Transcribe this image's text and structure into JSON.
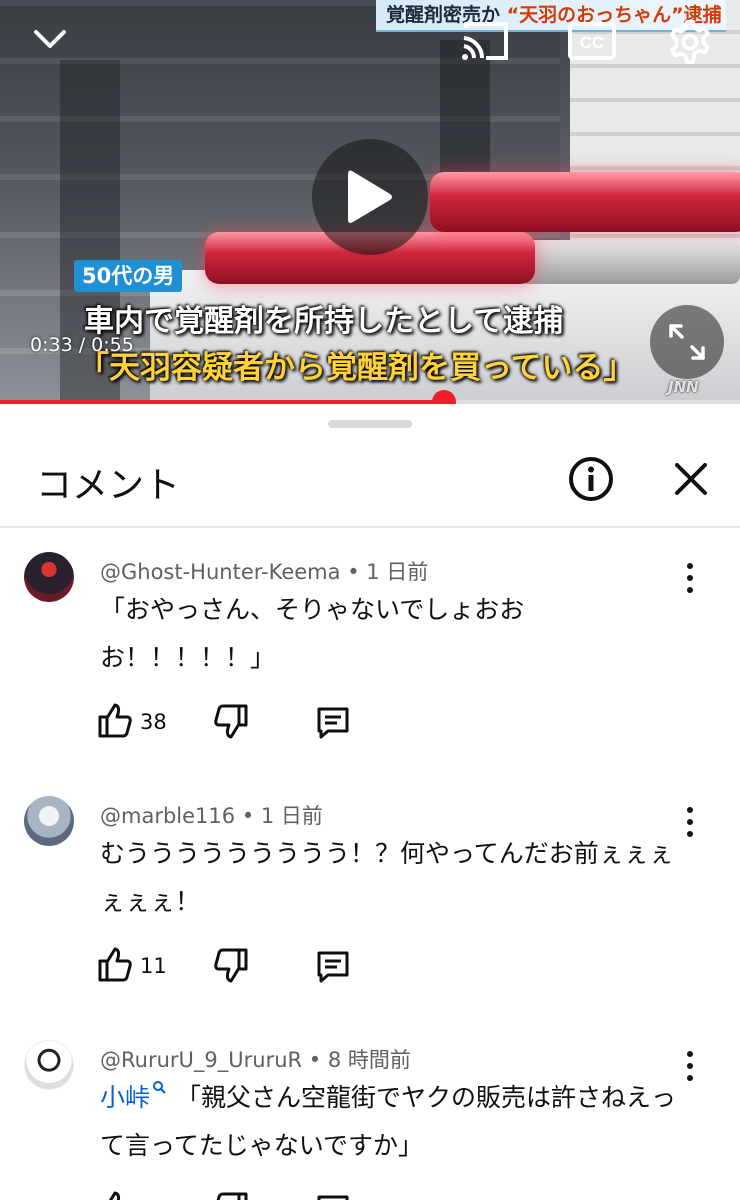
{
  "video": {
    "top_caption": "覚醒剤密売か",
    "top_caption_highlight": "“天羽のおっちゃん”逮捕",
    "tag": "50代の男",
    "subtitle_line1": "車内で覚醒剤を所持したとして逮捕",
    "subtitle_line2": "「天羽容疑者から覚醒剤を買っている」",
    "time": "0:33 / 0:55",
    "progress": 0.6,
    "watermark": "JNN",
    "icons": [
      "chevron-down-icon",
      "cast-icon",
      "closed-captions-icon",
      "settings-gear-icon",
      "play-icon",
      "fullscreen-icon"
    ]
  },
  "comments_panel": {
    "title": "コメント",
    "icons": [
      "info-icon",
      "close-icon"
    ],
    "comments": [
      {
        "author": "@Ghost-Hunter-Keema",
        "age": "1 日前",
        "text": "「おやっさん、そりゃないでしょおおお！！！！！」",
        "likes": "38"
      },
      {
        "author": "@marble116",
        "age": "1 日前",
        "text": "むううううううううう！？何やってんだお前ぇぇぇぇぇぇ！",
        "likes": "11"
      },
      {
        "author": "@RururU_9_UruruR",
        "age": "8 時間前",
        "mention": "小峠",
        "text": "「親父さん空龍街でヤクの販売は許さねえって言ってたじゃないですか」",
        "likes": ""
      }
    ]
  },
  "colors": {
    "progress_red": "#f01e2c",
    "link_blue": "#065fd4",
    "meta_gray": "#606060"
  }
}
